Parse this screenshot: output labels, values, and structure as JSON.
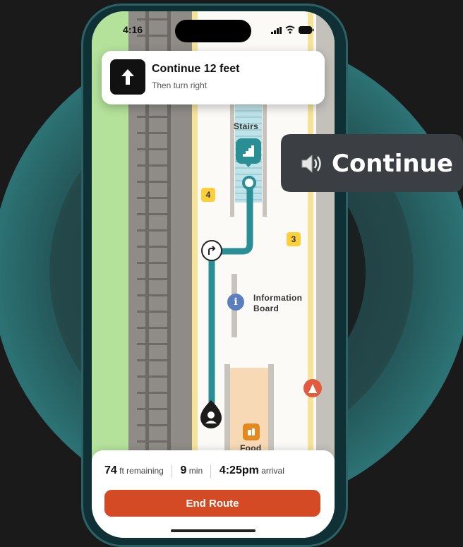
{
  "status_bar": {
    "time": "4:16"
  },
  "instruction": {
    "title": "Continue 12 feet",
    "subtitle": "Then turn right",
    "icon": "up-arrow-icon"
  },
  "voice_bubble": {
    "text": "Continue",
    "icon": "speaker-icon"
  },
  "map": {
    "stairs_label": "Stairs",
    "info_label_line1": "Information",
    "info_label_line2": "Board",
    "info_icon": "i",
    "food_label": "Food",
    "platform_badges": [
      "4",
      "3"
    ]
  },
  "trip": {
    "distance": "74",
    "distance_unit": "ft remaining",
    "duration": "9",
    "duration_unit": "min",
    "arrival_time": "4:25pm",
    "arrival_label": "arrival"
  },
  "end_button": {
    "label": "End Route"
  },
  "colors": {
    "route": "#2a8f95",
    "end_button": "#d44a25",
    "badge": "#ffcf3a",
    "background": "#1a1a1a"
  }
}
